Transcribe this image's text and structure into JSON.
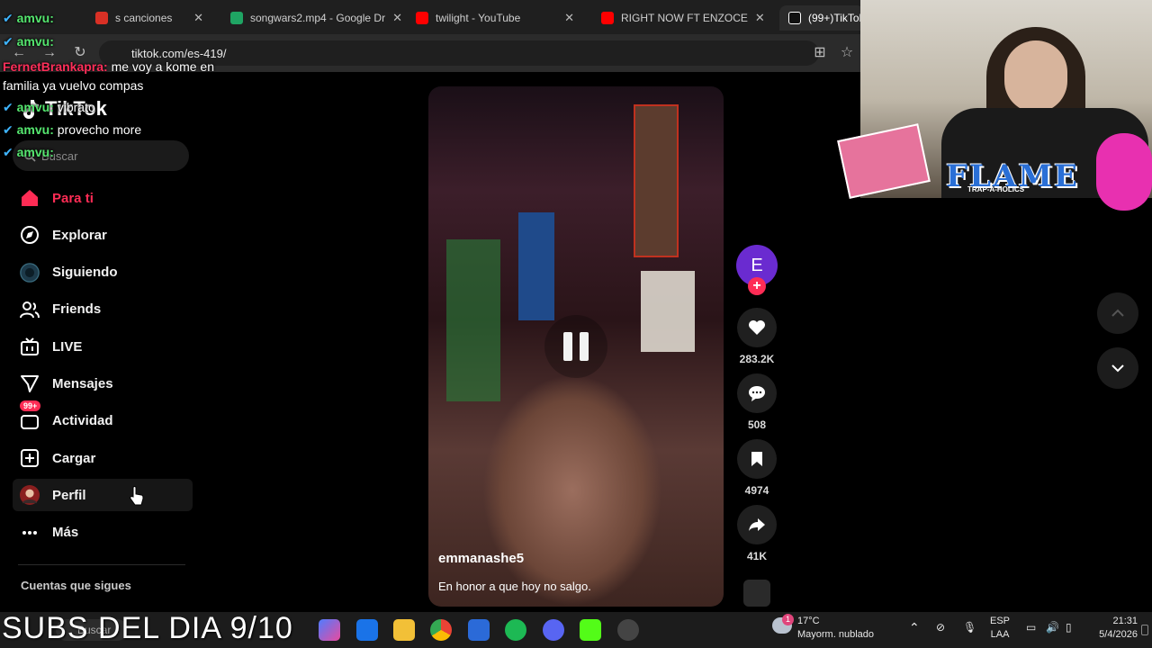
{
  "browser": {
    "tabs": [
      {
        "label": "s canciones",
        "color": "#d93025"
      },
      {
        "label": "songwars2.mp4 - Google Dr",
        "color": "#1fa463"
      },
      {
        "label": "twilight - YouTube",
        "color": "#ff0000"
      },
      {
        "label": "RIGHT NOW FT ENZOCE",
        "color": "#ff0000"
      },
      {
        "label": "(99+)TikTok",
        "color": "#ffffff"
      }
    ],
    "url": "tiktok.com/es-419/"
  },
  "chat": [
    {
      "user": "amvu:",
      "text": ""
    },
    {
      "user": "amvu:",
      "text": ""
    },
    {
      "user": "FernetBrankapra:",
      "text": "me voy a kome en"
    },
    {
      "user": "",
      "text": "familia ya vuelvo compas"
    },
    {
      "user": "amvu:",
      "text": "vibrato"
    },
    {
      "user": "amvu:",
      "text": "provecho more"
    },
    {
      "user": "amvu:",
      "text": ""
    }
  ],
  "sidebar": {
    "logo": "TikTok",
    "search_placeholder": "Buscar",
    "items": [
      {
        "label": "Para ti",
        "icon": "home-icon"
      },
      {
        "label": "Explorar",
        "icon": "compass-icon"
      },
      {
        "label": "Siguiendo",
        "icon": "following-icon"
      },
      {
        "label": "Friends",
        "icon": "friends-icon"
      },
      {
        "label": "LIVE",
        "icon": "live-icon"
      },
      {
        "label": "Mensajes",
        "icon": "send-icon"
      },
      {
        "label": "Actividad",
        "icon": "activity-icon"
      },
      {
        "label": "Cargar",
        "icon": "upload-icon"
      },
      {
        "label": "Perfil",
        "icon": "profile-icon"
      },
      {
        "label": "Más",
        "icon": "more-icon"
      }
    ],
    "activity_badge": "99+",
    "following_title": "Cuentas que sigues"
  },
  "video": {
    "username": "emmanashe5",
    "description": "En honor a que hoy no salgo."
  },
  "actions": {
    "avatar_letter": "E",
    "likes": "283.2K",
    "comments": "508",
    "saves": "4974",
    "shares": "41K"
  },
  "overlay": {
    "subs_text": "SUBS DEL DIA 9/10",
    "flame": "FLAME",
    "flame_sub": "TRAP-A-HOLICS"
  },
  "taskbar": {
    "search": "Buscar",
    "temperature": "17°C",
    "weather": "Mayorm. nublado",
    "weather_badge": "1",
    "lang": "ESP",
    "lang_sub": "LAA",
    "time": "21:31",
    "date": "5/4/2026"
  },
  "colors": {
    "accent": "#fe2c55",
    "chat_user": "#55e66f"
  }
}
